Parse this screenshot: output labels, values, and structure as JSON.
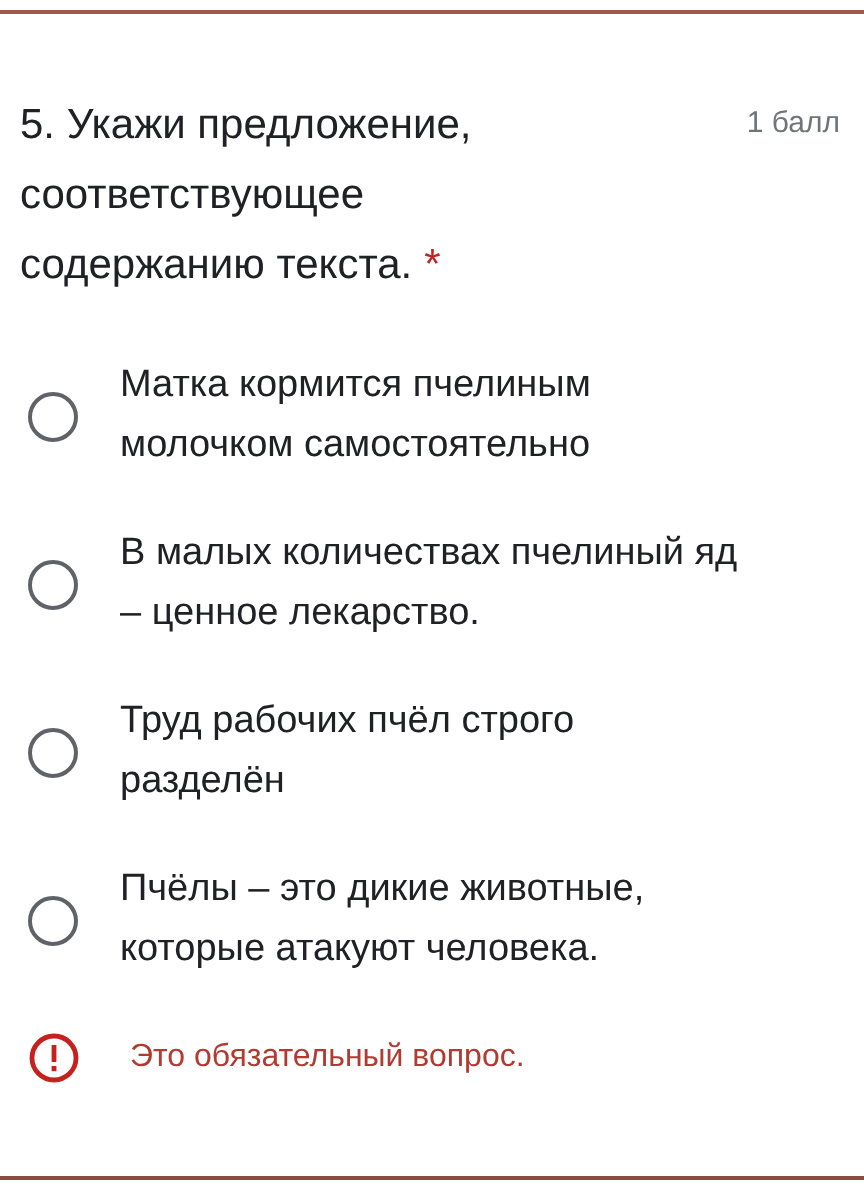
{
  "question": {
    "title": "5. Укажи предложение, соответствующее содержанию текста.",
    "required_mark": "*",
    "points": "1 балл"
  },
  "options": [
    {
      "label": "Матка кормится пчелиным молочком самостоятельно",
      "selected": false
    },
    {
      "label": "В малых количествах пчелиный яд – ценное лекарство.",
      "selected": false
    },
    {
      "label": "Труд рабочих пчёл строго разделён",
      "selected": false
    },
    {
      "label": "Пчёлы – это дикие животные, которые атакуют человека.",
      "selected": false
    }
  ],
  "error": {
    "message": "Это обязательный вопрос."
  }
}
